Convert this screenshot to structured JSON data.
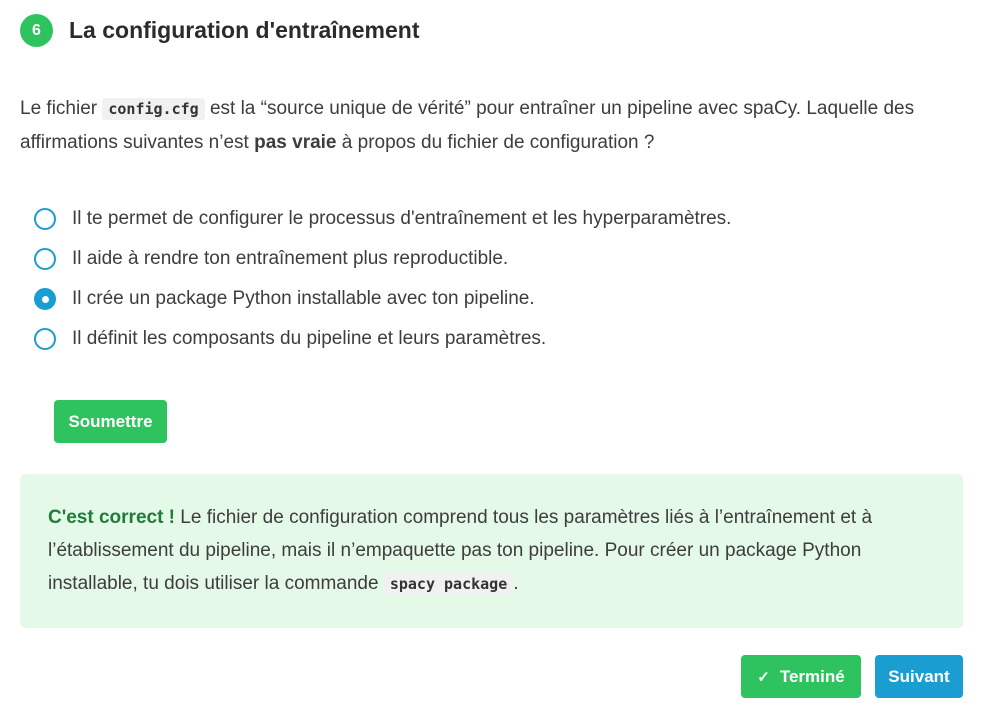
{
  "header": {
    "step_number": "6",
    "title": "La configuration d'entraînement"
  },
  "question": {
    "text_before": "Le fichier ",
    "code": "config.cfg",
    "text_middle": " est la “source unique de vérité” pour entraîner un pipeline avec spaCy. Laquelle des affirmations suivantes n’est ",
    "emphasis": "pas vraie",
    "text_after": " à propos du fichier de configuration ?"
  },
  "options": [
    {
      "label": "Il te permet de configurer le processus d'entraînement et les hyperparamètres.",
      "selected": false
    },
    {
      "label": "Il aide à rendre ton entraînement plus reproductible.",
      "selected": false
    },
    {
      "label": "Il crée un package Python installable avec ton pipeline.",
      "selected": true
    },
    {
      "label": "Il définit les composants du pipeline et leurs paramètres.",
      "selected": false
    }
  ],
  "submit_label": "Soumettre",
  "feedback": {
    "correct_label": "C'est correct !",
    "text": " Le fichier de configuration comprend tous les paramètres liés à l’entraînement et à l’établissement du pipeline, mais il n’empaquette pas ton pipeline. Pour créer un package Python installable, tu dois utiliser la commande ",
    "code": "spacy package",
    "text_end": "."
  },
  "footer": {
    "done_label": "Terminé",
    "next_label": "Suivant"
  },
  "colors": {
    "green": "#2ec35e",
    "blue": "#1a9dd0",
    "feedback_bg": "#e4f9e8"
  },
  "icons": {
    "done": "check-icon"
  }
}
